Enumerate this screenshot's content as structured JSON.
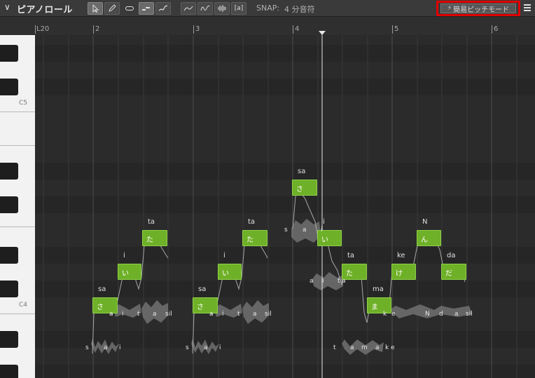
{
  "toolbar": {
    "title": "ピアノロール",
    "snap_label": "SNAP:",
    "snap_value": "4 分音符",
    "pitch_mode_label": "簡易ピッチモード",
    "text_tool_label": "[a]"
  },
  "ruler": {
    "bars": [
      {
        "label": "L20"
      },
      {
        "label": "2"
      },
      {
        "label": "3"
      },
      {
        "label": "4"
      },
      {
        "label": "5"
      },
      {
        "label": "6"
      }
    ]
  },
  "keys": {
    "c5": "C5",
    "c4": "C4"
  },
  "notes": [
    {
      "lyric": "sa",
      "kana": "さ"
    },
    {
      "lyric": "i",
      "kana": "い"
    },
    {
      "lyric": "ta",
      "kana": "た"
    },
    {
      "lyric": "sa",
      "kana": "さ"
    },
    {
      "lyric": "i",
      "kana": "い"
    },
    {
      "lyric": "ta",
      "kana": "た"
    },
    {
      "lyric": "sa",
      "kana": "さ"
    },
    {
      "lyric": "i",
      "kana": "い"
    },
    {
      "lyric": "ta",
      "kana": "た"
    },
    {
      "lyric": "ma",
      "kana": "ま"
    },
    {
      "lyric": "ke",
      "kana": "け"
    },
    {
      "lyric": "N",
      "kana": "ん"
    },
    {
      "lyric": "da",
      "kana": "だ"
    }
  ],
  "phonemes": [
    {
      "text": "a"
    },
    {
      "text": "i"
    },
    {
      "text": "t"
    },
    {
      "text": "a"
    },
    {
      "text": "sil"
    },
    {
      "text": "s"
    },
    {
      "text": "a"
    },
    {
      "text": "i"
    },
    {
      "text": "a"
    },
    {
      "text": "i"
    },
    {
      "text": "t"
    },
    {
      "text": "a"
    },
    {
      "text": "sil"
    },
    {
      "text": "s"
    },
    {
      "text": "a"
    },
    {
      "text": "i"
    },
    {
      "text": "s"
    },
    {
      "text": "a"
    },
    {
      "text": "i"
    },
    {
      "text": "a"
    },
    {
      "text": "i"
    },
    {
      "text": "t"
    },
    {
      "text": "a"
    },
    {
      "text": "k"
    },
    {
      "text": "e"
    },
    {
      "text": "N"
    },
    {
      "text": "d"
    },
    {
      "text": "a"
    },
    {
      "text": "sil"
    },
    {
      "text": "t"
    },
    {
      "text": "a"
    },
    {
      "text": "m"
    },
    {
      "text": "a"
    },
    {
      "text": "k"
    },
    {
      "text": "e"
    }
  ],
  "colors": {
    "note_fill": "#6eb027",
    "highlight": "#e00000"
  }
}
